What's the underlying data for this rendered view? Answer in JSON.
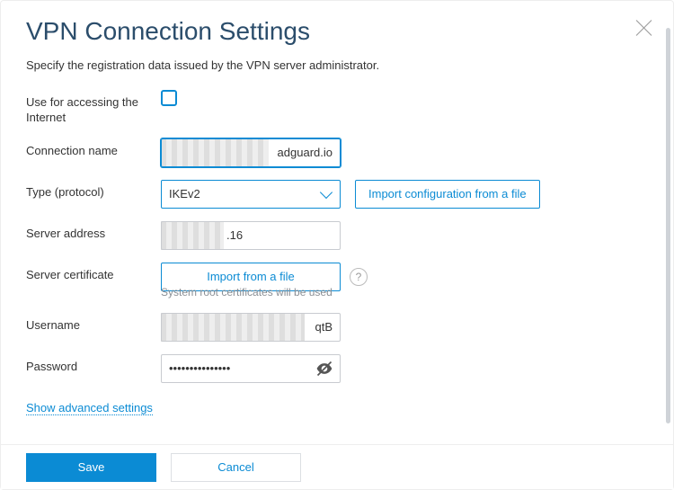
{
  "title": "VPN Connection Settings",
  "subtitle": "Specify the registration data issued by the VPN server administrator.",
  "fields": {
    "use_internet_label": "Use for accessing the Internet",
    "connection_name_label": "Connection name",
    "connection_name_value": "adguard.io",
    "type_label": "Type (protocol)",
    "type_value": "IKEv2",
    "import_config_label": "Import configuration from a file",
    "server_address_label": "Server address",
    "server_address_value": ".16",
    "server_cert_label": "Server certificate",
    "import_file_label": "Import from a file",
    "cert_hint": "System root certificates will be used",
    "username_label": "Username",
    "username_value": "qtB",
    "password_label": "Password",
    "password_value": "•••••••••••••••"
  },
  "advanced_link": "Show advanced settings",
  "buttons": {
    "save": "Save",
    "cancel": "Cancel"
  }
}
